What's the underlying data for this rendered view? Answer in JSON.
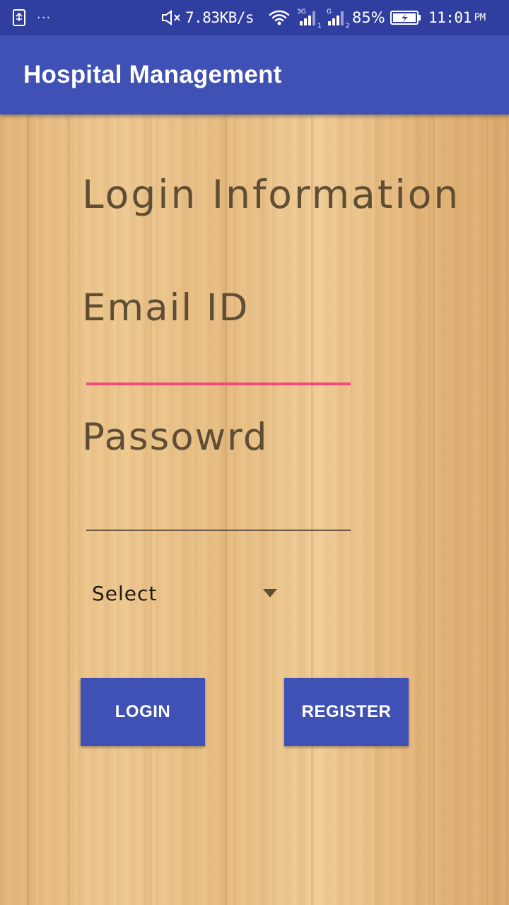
{
  "status_bar": {
    "dots": "···",
    "network_speed": "7.83KB/s",
    "sim1_label": "3G",
    "sim2_label": "G",
    "battery_percent": "85%",
    "time": "11:01",
    "am_pm": "PM"
  },
  "app_bar": {
    "title": "Hospital Management"
  },
  "form": {
    "heading": "Login Information",
    "email_label": "Email ID",
    "email_value": "",
    "password_label": "Passowrd",
    "password_value": "",
    "role_selected": "Select",
    "login_button": "LOGIN",
    "register_button": "REGISTER"
  },
  "colors": {
    "status_bar": "#303f9f",
    "app_bar": "#3f51b5",
    "accent_underline": "#f04a7e",
    "label_text": "#5f4e34",
    "button": "#3f51b5"
  }
}
